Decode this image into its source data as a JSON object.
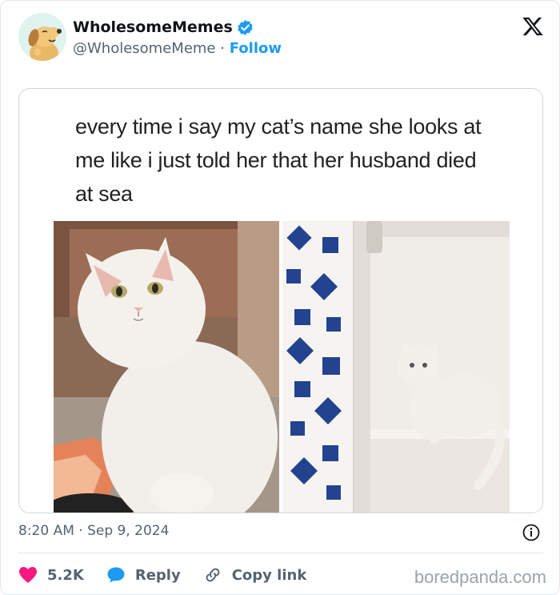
{
  "account": {
    "display_name": "WholesomeMemes",
    "handle": "@WholesomeMeme",
    "separator": "·",
    "follow_label": "Follow"
  },
  "post": {
    "caption": "every time i say my cat’s name she looks at me like i just told her that her husband died at sea",
    "timestamp": "8:20 AM · Sep 9, 2024"
  },
  "actions": {
    "likes": "5.2K",
    "reply_label": "Reply",
    "copy_label": "Copy link"
  },
  "watermark": "boredpanda.com",
  "colors": {
    "accent": "#1d9bf0",
    "like": "#f91880",
    "muted": "#536471",
    "text": "#0f1419"
  },
  "icons": [
    "avatar-dog",
    "verified-badge-icon",
    "x-logo-icon",
    "info-icon",
    "heart-icon",
    "reply-bubble-icon",
    "link-icon"
  ]
}
